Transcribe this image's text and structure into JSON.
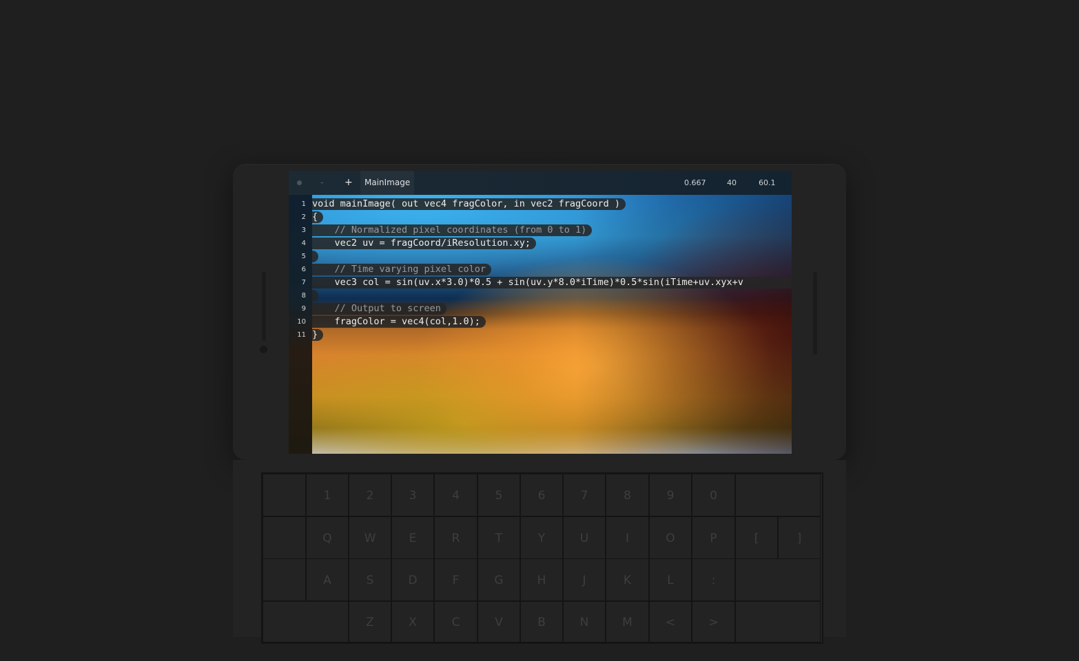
{
  "toolbar": {
    "minus_label": "-",
    "plus_label": "+",
    "tab_label": "MainImage",
    "stats": [
      "0.667",
      "40",
      "60.1"
    ]
  },
  "code_lines": [
    {
      "n": "1",
      "text": "void mainImage( out vec4 fragColor, in vec2 fragCoord )",
      "comment": false
    },
    {
      "n": "2",
      "text": "{",
      "comment": false
    },
    {
      "n": "3",
      "text": "    // Normalized pixel coordinates (from 0 to 1)",
      "comment": true
    },
    {
      "n": "4",
      "text": "    vec2 uv = fragCoord/iResolution.xy;",
      "comment": false
    },
    {
      "n": "5",
      "text": "",
      "comment": false
    },
    {
      "n": "6",
      "text": "    // Time varying pixel color",
      "comment": true
    },
    {
      "n": "7",
      "text": "    vec3 col = sin(uv.x*3.0)*0.5 + sin(uv.y*8.0*iTime)*0.5*sin(iTime+uv.xyx+v",
      "comment": false
    },
    {
      "n": "8",
      "text": "",
      "comment": false
    },
    {
      "n": "9",
      "text": "    // Output to screen",
      "comment": true
    },
    {
      "n": "10",
      "text": "    fragColor = vec4(col,1.0);",
      "comment": false
    },
    {
      "n": "11",
      "text": "}",
      "comment": false
    }
  ],
  "keyboard": {
    "row1": [
      "",
      "1",
      "2",
      "3",
      "4",
      "5",
      "6",
      "7",
      "8",
      "9",
      "0",
      ""
    ],
    "row2": [
      "",
      "Q",
      "W",
      "E",
      "R",
      "T",
      "Y",
      "U",
      "I",
      "O",
      "P",
      "[",
      "]"
    ],
    "row3": [
      "",
      "A",
      "S",
      "D",
      "F",
      "G",
      "H",
      "J",
      "K",
      "L",
      ":",
      ""
    ],
    "row4": [
      "",
      "Z",
      "X",
      "C",
      "V",
      "B",
      "N",
      "M",
      "<",
      ">",
      ""
    ]
  }
}
